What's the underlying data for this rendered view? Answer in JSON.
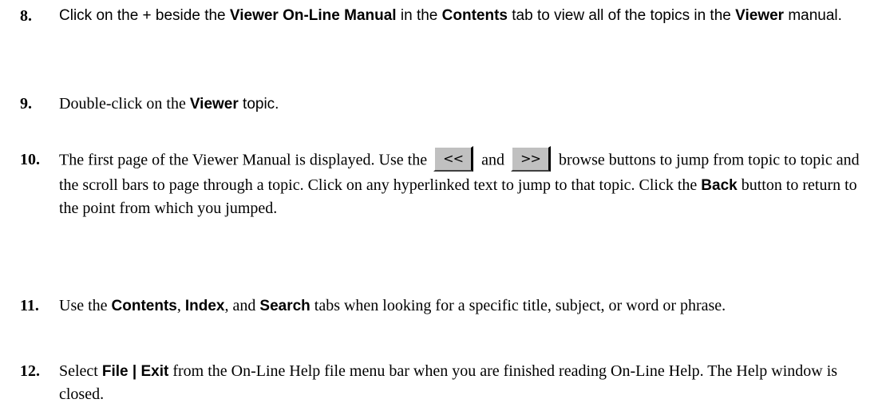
{
  "steps": [
    {
      "number": "8.",
      "t1": "Click on the + beside the ",
      "b1": "Viewer On-Line Manual",
      "t2": " in the ",
      "b2": "Contents",
      "t3": " tab to view all of the topics in the ",
      "b3": "Viewer",
      "t4": " manual."
    },
    {
      "number": "9.",
      "t1": "Double-click on the ",
      "b1": "Viewer",
      "t2": " topic."
    },
    {
      "number": "10.",
      "t1": "The first page of the Viewer Manual is displayed. Use the",
      "prev_button": "<<",
      "t2": "and",
      "next_button": ">>",
      "t3": "browse buttons to jump from topic to topic and the scroll bars to page through a topic. Click on any hyperlinked text to jump to that topic. Click the ",
      "b1": "Back",
      "t4": " button to return to the point from which you jumped."
    },
    {
      "number": "11.",
      "t1": "Use the ",
      "b1": "Contents",
      "t2": ", ",
      "b2": "Index",
      "t3": ", and ",
      "b3": "Search",
      "t4": " tabs when looking for a specific title, subject, or word or phrase."
    },
    {
      "number": "12.",
      "t1": "Select ",
      "b1": "File | Exit",
      "t2": " from the On-Line Help file menu bar when you are finished reading On-Line Help. The Help window is closed."
    }
  ]
}
